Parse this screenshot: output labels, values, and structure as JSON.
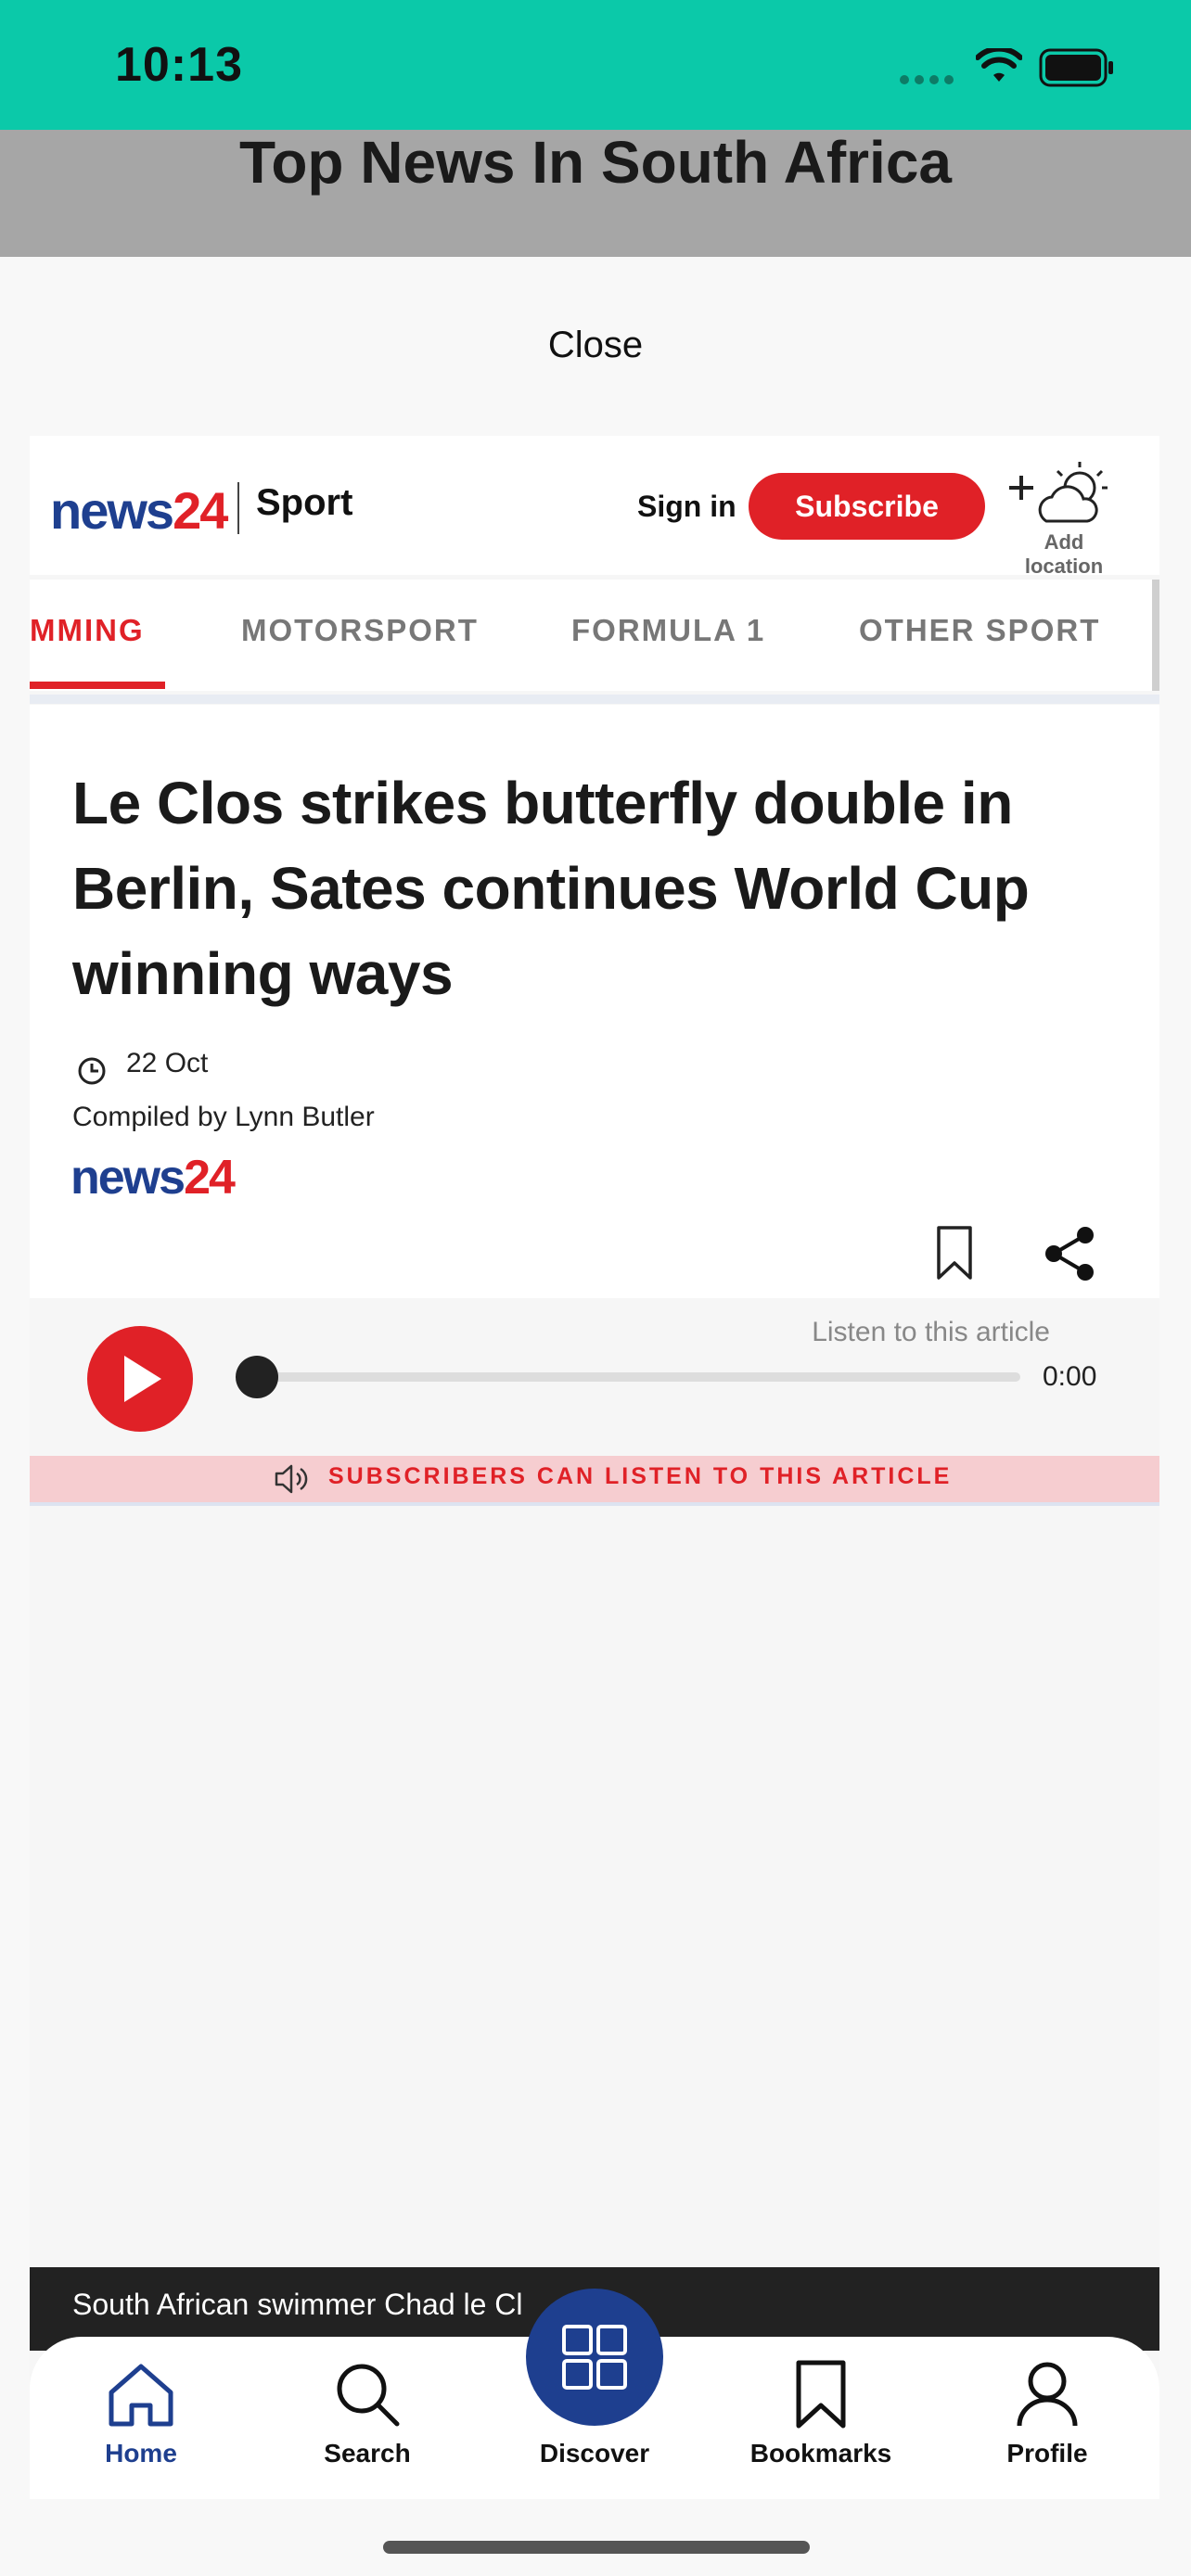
{
  "status": {
    "time": "10:13"
  },
  "header": {
    "title": "Top News In South Africa"
  },
  "modal": {
    "close_label": "Close"
  },
  "site": {
    "logo_news": "news",
    "logo_num": "24",
    "section": "Sport",
    "sign_in": "Sign in",
    "subscribe": "Subscribe",
    "add_location": "Add location"
  },
  "nav": {
    "tabs": [
      {
        "label": "MMING",
        "active": true
      },
      {
        "label": "MOTORSPORT"
      },
      {
        "label": "FORMULA 1"
      },
      {
        "label": "OTHER SPORT"
      }
    ]
  },
  "article": {
    "headline": "Le Clos strikes butterfly double in Berlin, Sates continues World Cup winning ways",
    "date": "22 Oct",
    "byline": "Compiled by Lynn Butler",
    "brand_news": "news",
    "brand_num": "24"
  },
  "player": {
    "listen_label": "Listen to this article",
    "time": "0:00",
    "progress": 0,
    "subscribers_banner": "SUBSCRIBERS CAN LISTEN TO THIS ARTICLE"
  },
  "caption": {
    "text": "South African swimmer Chad le Cl"
  },
  "tabbar": {
    "items": [
      {
        "label": "Home",
        "icon": "home-icon",
        "active": true
      },
      {
        "label": "Search",
        "icon": "search-icon"
      },
      {
        "label": "Discover",
        "icon": "grid-icon"
      },
      {
        "label": "Bookmarks",
        "icon": "bookmark-icon"
      },
      {
        "label": "Profile",
        "icon": "person-icon"
      }
    ]
  },
  "colors": {
    "status_bar": "#0bc9a9",
    "brand_red": "#e02127",
    "brand_blue": "#1e3f8f"
  }
}
